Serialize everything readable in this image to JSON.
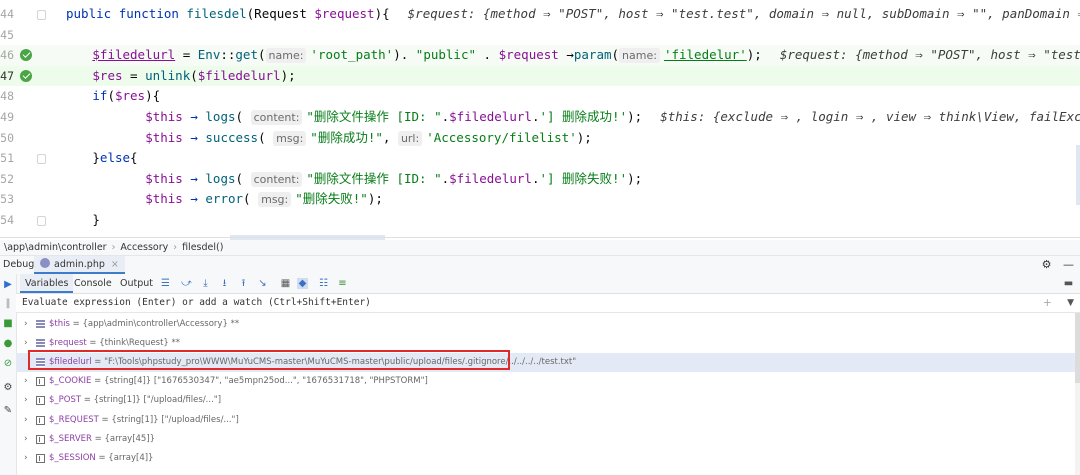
{
  "editor": {
    "lines": [
      {
        "num": "44",
        "fold": true,
        "parts": [
          {
            "c": "kw",
            "t": "public "
          },
          {
            "c": "kw",
            "t": "function "
          },
          {
            "c": "fn",
            "t": "filesdel"
          },
          {
            "c": "",
            "t": "(Request "
          },
          {
            "c": "var",
            "t": "$request"
          },
          {
            "c": "",
            "t": "){"
          }
        ],
        "inline": "$request: {method ⇒ \"POST\", host ⇒ \"test.test\", domain ⇒ null, subDomain ⇒ \"\", panDomain ⇒ null, url ⇒ \""
      },
      {
        "num": "45",
        "parts": []
      },
      {
        "num": "46",
        "bp": true,
        "indent": 2,
        "parts": [
          {
            "c": "var u",
            "t": "$filedelurl"
          },
          {
            "c": "",
            " t": ""
          },
          {
            "c": "",
            "t": " = "
          },
          {
            "c": "fn",
            "t": "Env"
          },
          {
            "c": "",
            "t": "::"
          },
          {
            "c": "fn",
            "t": "get"
          },
          {
            "c": "",
            "t": "("
          },
          {
            "c": "hint",
            "t": "name:"
          },
          {
            "c": "str",
            "t": "'root_path'"
          },
          {
            "c": "",
            "t": "). "
          },
          {
            "c": "str",
            "t": "\"public\""
          },
          {
            "c": "",
            "t": " . "
          },
          {
            "c": "var",
            "t": "$request"
          },
          {
            "c": "",
            " t": ""
          },
          {
            "c": "",
            "t": " →"
          },
          {
            "c": "fn",
            "t": "param"
          },
          {
            "c": "",
            "t": "("
          },
          {
            "c": "hint",
            "t": "name:"
          },
          {
            "c": "str u",
            "t": "'filedelur'"
          },
          {
            "c": "",
            "t": ");"
          }
        ],
        "inline": "$request: {method ⇒ \"POST\", host ⇒ \"test.test\", domain ⇒ n"
      },
      {
        "num": "47",
        "bp": true,
        "cur": true,
        "indent": 2,
        "parts": [
          {
            "c": "var",
            "t": "$res"
          },
          {
            "c": "",
            "t": " = "
          },
          {
            "c": "fn",
            "t": "unlink"
          },
          {
            "c": "",
            "t": "("
          },
          {
            "c": "var",
            "t": "$filedelurl"
          },
          {
            "c": "",
            "t": ");"
          }
        ]
      },
      {
        "num": "48",
        "indent": 2,
        "parts": [
          {
            "c": "kw",
            "t": "if"
          },
          {
            "c": "",
            "t": "("
          },
          {
            "c": "var",
            "t": "$res"
          },
          {
            "c": "",
            "t": "){"
          }
        ]
      },
      {
        "num": "49",
        "indent": 6,
        "parts": [
          {
            "c": "var",
            "t": "$this"
          },
          {
            "c": "kw",
            "t": " → "
          },
          {
            "c": "fn",
            "t": "logs"
          },
          {
            "c": "",
            "t": "( "
          },
          {
            "c": "hint",
            "t": "content:"
          },
          {
            "c": "str",
            "t": "\"删除文件操作 [ID: \""
          },
          {
            "c": "",
            "t": "."
          },
          {
            "c": "var",
            "t": "$filedelurl"
          },
          {
            "c": "",
            "t": "."
          },
          {
            "c": "str",
            "t": "'] 删除成功!'"
          },
          {
            "c": "",
            "t": ");"
          }
        ],
        "inline": "$this: {exclude ⇒ , login ⇒ , view ⇒ think\\View, failException ⇒ false,"
      },
      {
        "num": "50",
        "indent": 6,
        "parts": [
          {
            "c": "var",
            "t": "$this"
          },
          {
            "c": "kw",
            "t": " → "
          },
          {
            "c": "fn",
            "t": "success"
          },
          {
            "c": "",
            "t": "( "
          },
          {
            "c": "hint",
            "t": "msg:"
          },
          {
            "c": "str",
            "t": "\"删除成功!\""
          },
          {
            "c": "",
            "t": ", "
          },
          {
            "c": "hint",
            "t": "url:"
          },
          {
            "c": "str",
            "t": "'Accessory/filelist'"
          },
          {
            "c": "",
            "t": ");"
          }
        ]
      },
      {
        "num": "51",
        "fold": true,
        "indent": 2,
        "parts": [
          {
            "c": "",
            "t": "}"
          },
          {
            "c": "kw",
            "t": "else"
          },
          {
            "c": "",
            "t": "{"
          }
        ]
      },
      {
        "num": "52",
        "indent": 6,
        "parts": [
          {
            "c": "var",
            "t": "$this"
          },
          {
            "c": "kw",
            "t": " → "
          },
          {
            "c": "fn",
            "t": "logs"
          },
          {
            "c": "",
            "t": "( "
          },
          {
            "c": "hint",
            "t": "content:"
          },
          {
            "c": "str",
            "t": "\"删除文件操作 [ID: \""
          },
          {
            "c": "",
            "t": "."
          },
          {
            "c": "var",
            "t": "$filedelurl"
          },
          {
            "c": "",
            "t": "."
          },
          {
            "c": "str",
            "t": "'] 删除失败!'"
          },
          {
            "c": "",
            "t": ");"
          }
        ]
      },
      {
        "num": "53",
        "indent": 6,
        "parts": [
          {
            "c": "var",
            "t": "$this"
          },
          {
            "c": "kw",
            "t": " → "
          },
          {
            "c": "fn",
            "t": "error"
          },
          {
            "c": "",
            "t": "( "
          },
          {
            "c": "hint",
            "t": "msg:"
          },
          {
            "c": "str",
            "t": "\"删除失败!\""
          },
          {
            "c": "",
            "t": ");"
          }
        ]
      },
      {
        "num": "54",
        "fold": true,
        "indent": 2,
        "parts": [
          {
            "c": "",
            "t": "}"
          }
        ]
      }
    ]
  },
  "breadcrumb": {
    "items": [
      "\\app\\admin\\controller",
      "Accessory",
      "filesdel()"
    ]
  },
  "debug": {
    "label": "Debug:",
    "tab": "admin.php",
    "tab_close": "×"
  },
  "subtabs": {
    "variables": "Variables",
    "console": "Console",
    "output": "Output"
  },
  "eval": {
    "placeholder": "Evaluate expression (Enter) or add a watch (Ctrl+Shift+Enter)"
  },
  "variables": [
    {
      "name": "$this",
      "value": " = {app\\admin\\controller\\Accessory} **",
      "expand": true,
      "icon": "obj"
    },
    {
      "name": "$request",
      "value": " = {think\\Request} **",
      "expand": true,
      "icon": "obj"
    },
    {
      "name": "$filedelurl",
      "value": " = \"F:\\Tools\\phpstudy_pro\\WWW\\MuYuCMS-master\\MuYuCMS-master\\public/upload/files/.gitignore/../../../../test.txt\"",
      "expand": false,
      "icon": "obj",
      "highlight": true
    },
    {
      "name": "$_COOKIE",
      "value": " = {string[4]} [\"1676530347\", \"ae5mpn25od...\", \"1676531718\", \"PHPSTORM\"]",
      "expand": true,
      "icon": "arr"
    },
    {
      "name": "$_POST",
      "value": " = {string[1]} [\"/upload/files/...\"]",
      "expand": true,
      "icon": "arr"
    },
    {
      "name": "$_REQUEST",
      "value": " = {string[1]} [\"/upload/files/...\"]",
      "expand": true,
      "icon": "arr"
    },
    {
      "name": "$_SERVER",
      "value": " = {array[45]}",
      "expand": true,
      "icon": "arr"
    },
    {
      "name": "$_SESSION",
      "value": " = {array[4]}",
      "expand": true,
      "icon": "arr"
    }
  ],
  "colors": {
    "breakpoint": "#4aa546",
    "current_line": "#edfceb",
    "highlight_box": "#e02a2a"
  }
}
